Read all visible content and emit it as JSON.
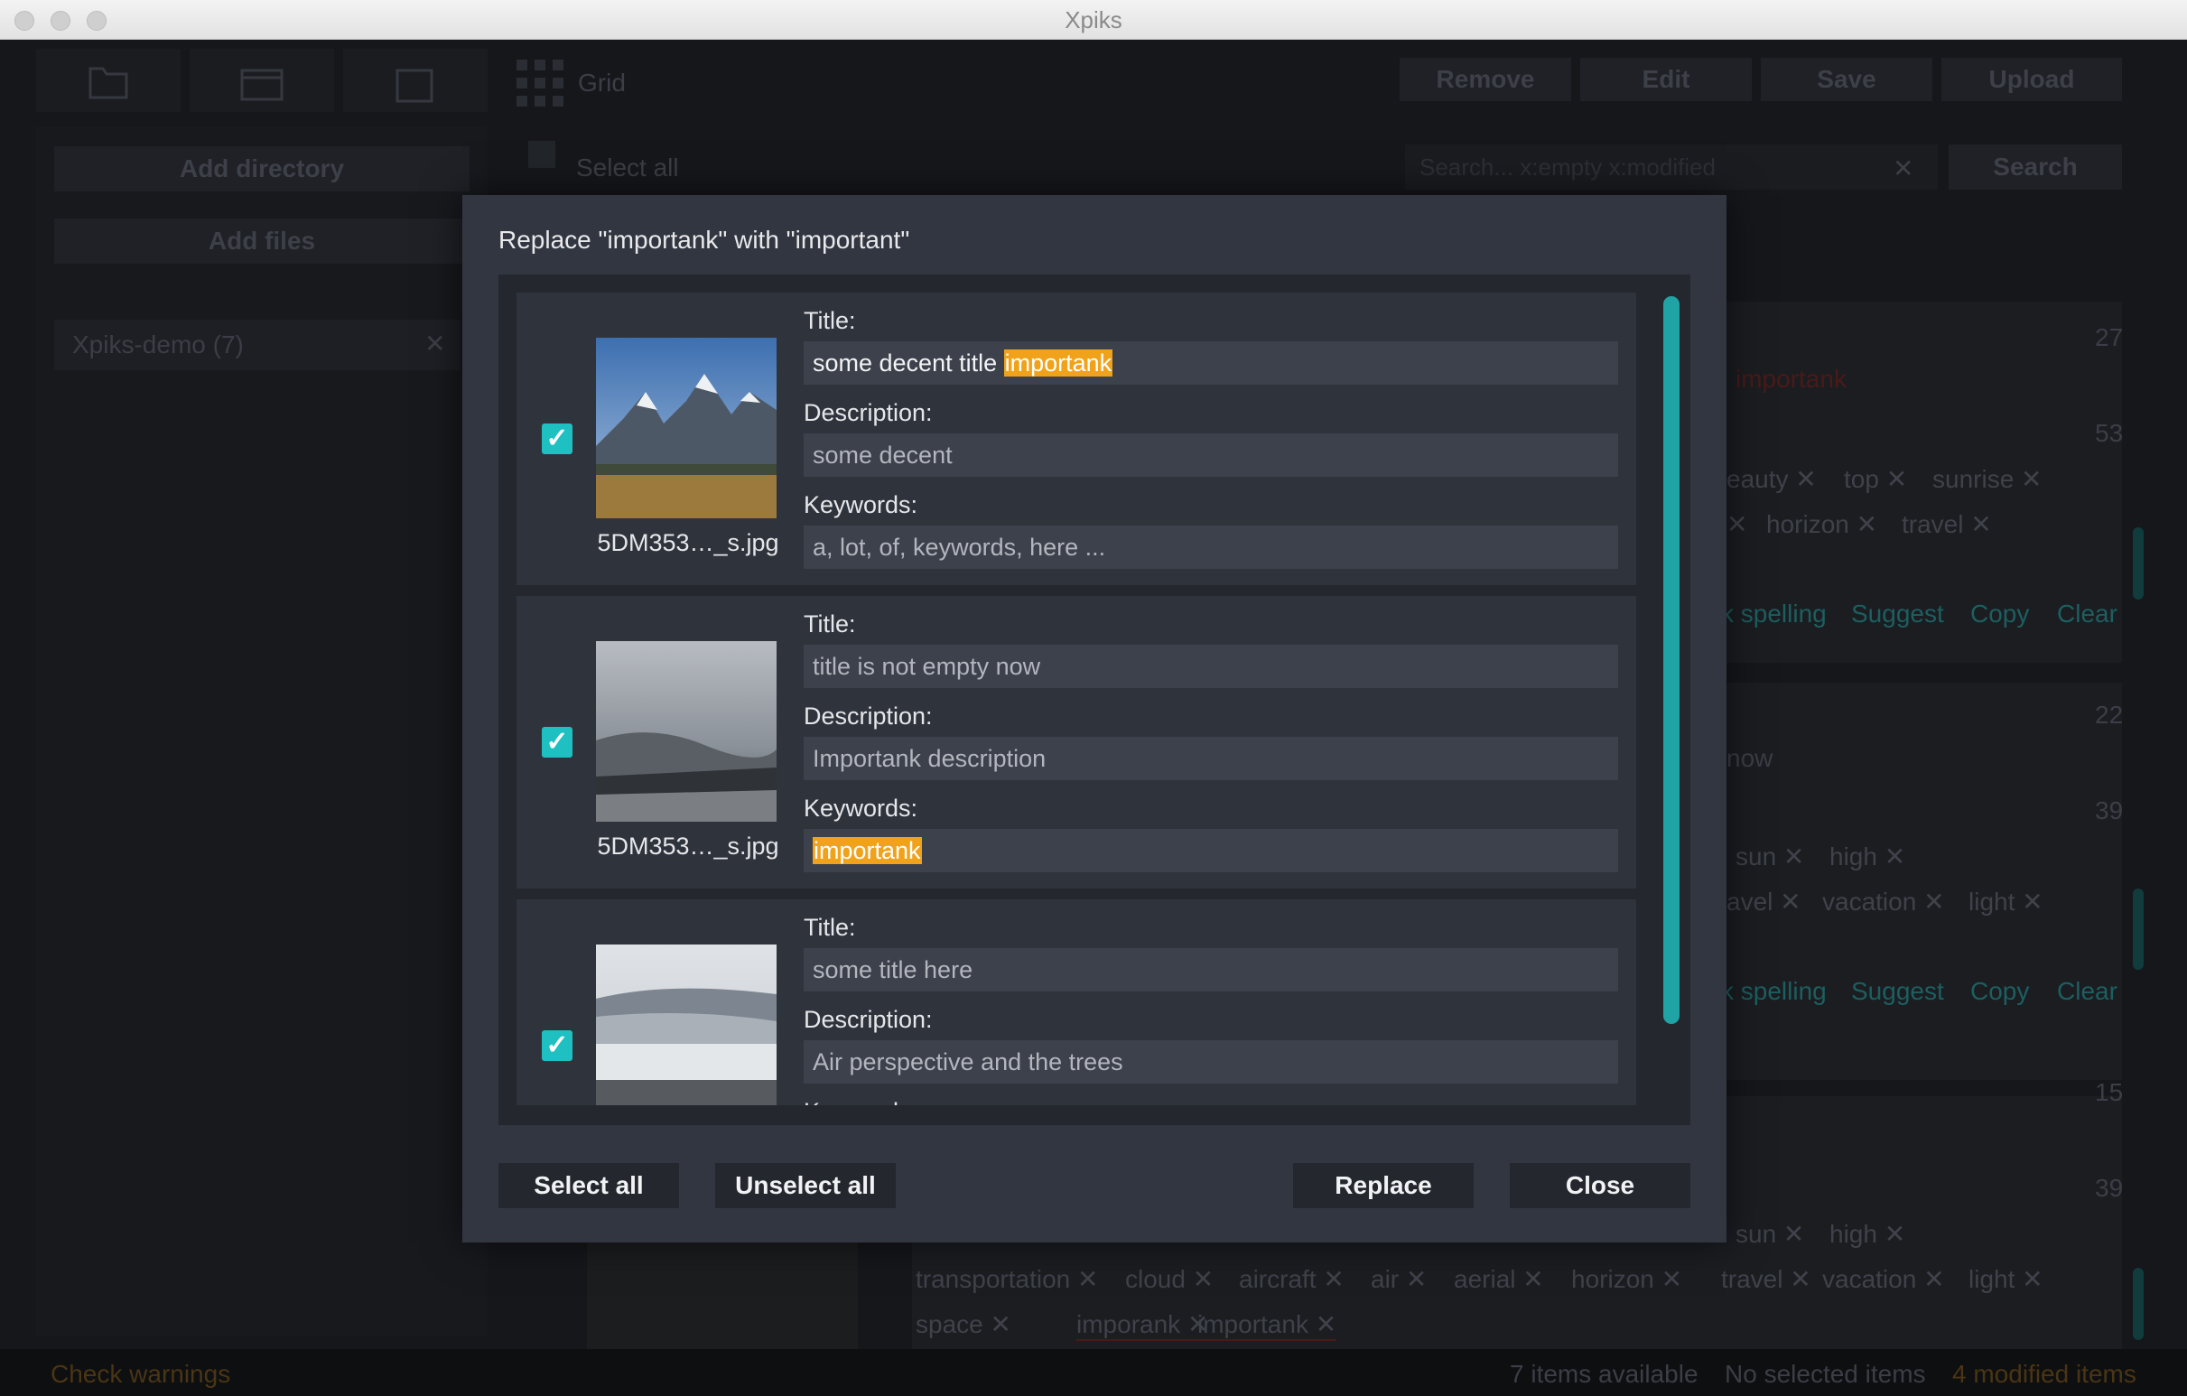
{
  "window": {
    "title": "Xpiks"
  },
  "toolbar": {
    "grid_label": "Grid",
    "remove": "Remove",
    "edit": "Edit",
    "save": "Save",
    "upload": "Upload"
  },
  "left": {
    "add_directory": "Add directory",
    "add_files": "Add files",
    "directory_item": "Xpiks-demo (7)"
  },
  "main": {
    "select_all": "Select all",
    "search_placeholder": "Search...   x:empty  x:modified",
    "search_button": "Search",
    "bg_counts": [
      "27",
      "53",
      "22",
      "39",
      "15",
      "39"
    ],
    "bg_row1_title_fragment": "importank",
    "bg_row1_keywords_a": [
      "eauty",
      "top",
      "sunrise"
    ],
    "bg_row1_keywords_b": [
      "horizon",
      "travel"
    ],
    "bg_row1_links": [
      "k spelling",
      "Suggest",
      "Copy",
      "Clear"
    ],
    "bg_row2_title_fragment": "now",
    "bg_row2_keywords_a": [
      "sun",
      "high"
    ],
    "bg_row2_keywords_b": [
      "avel",
      "vacation",
      "light"
    ],
    "bg_row2_links": [
      "k spelling",
      "Suggest",
      "Copy",
      "Clear"
    ],
    "bg_row3_keywords_a": [
      "sun",
      "high"
    ],
    "bg_row3_keywords_b": [
      "transportation",
      "cloud",
      "aircraft",
      "air",
      "aerial",
      "horizon",
      "travel",
      "vacation",
      "light"
    ],
    "bg_row3_keywords_c": [
      "space",
      "imporank",
      "importank"
    ]
  },
  "status": {
    "check_warnings": "Check warnings",
    "items_available": "7 items available",
    "selected": "No selected items",
    "modified": "4 modified items"
  },
  "dialog": {
    "title": "Replace \"importank\" with \"important\"",
    "title_label": "Title:",
    "description_label": "Description:",
    "keywords_label": "Keywords:",
    "items": [
      {
        "checked": true,
        "filename": "5DM353…_s.jpg",
        "title_text": "some decent title ",
        "title_hl": "importank",
        "description": "some decent",
        "keywords": "a, lot, of, keywords, here ..."
      },
      {
        "checked": true,
        "filename": "5DM353…_s.jpg",
        "title_text": "title is not empty now",
        "description": "Importank description",
        "keywords_hl": "importank"
      },
      {
        "checked": true,
        "title_text": "some title here",
        "description": "Air perspective and the trees",
        "keywords_label_partial": "Keywords:"
      }
    ],
    "buttons": {
      "select_all": "Select all",
      "unselect_all": "Unselect all",
      "replace": "Replace",
      "close": "Close"
    }
  },
  "colors": {
    "accent_teal": "#1ec0c2",
    "highlight_orange": "#f0a21a",
    "dialog_bg": "#323640"
  }
}
